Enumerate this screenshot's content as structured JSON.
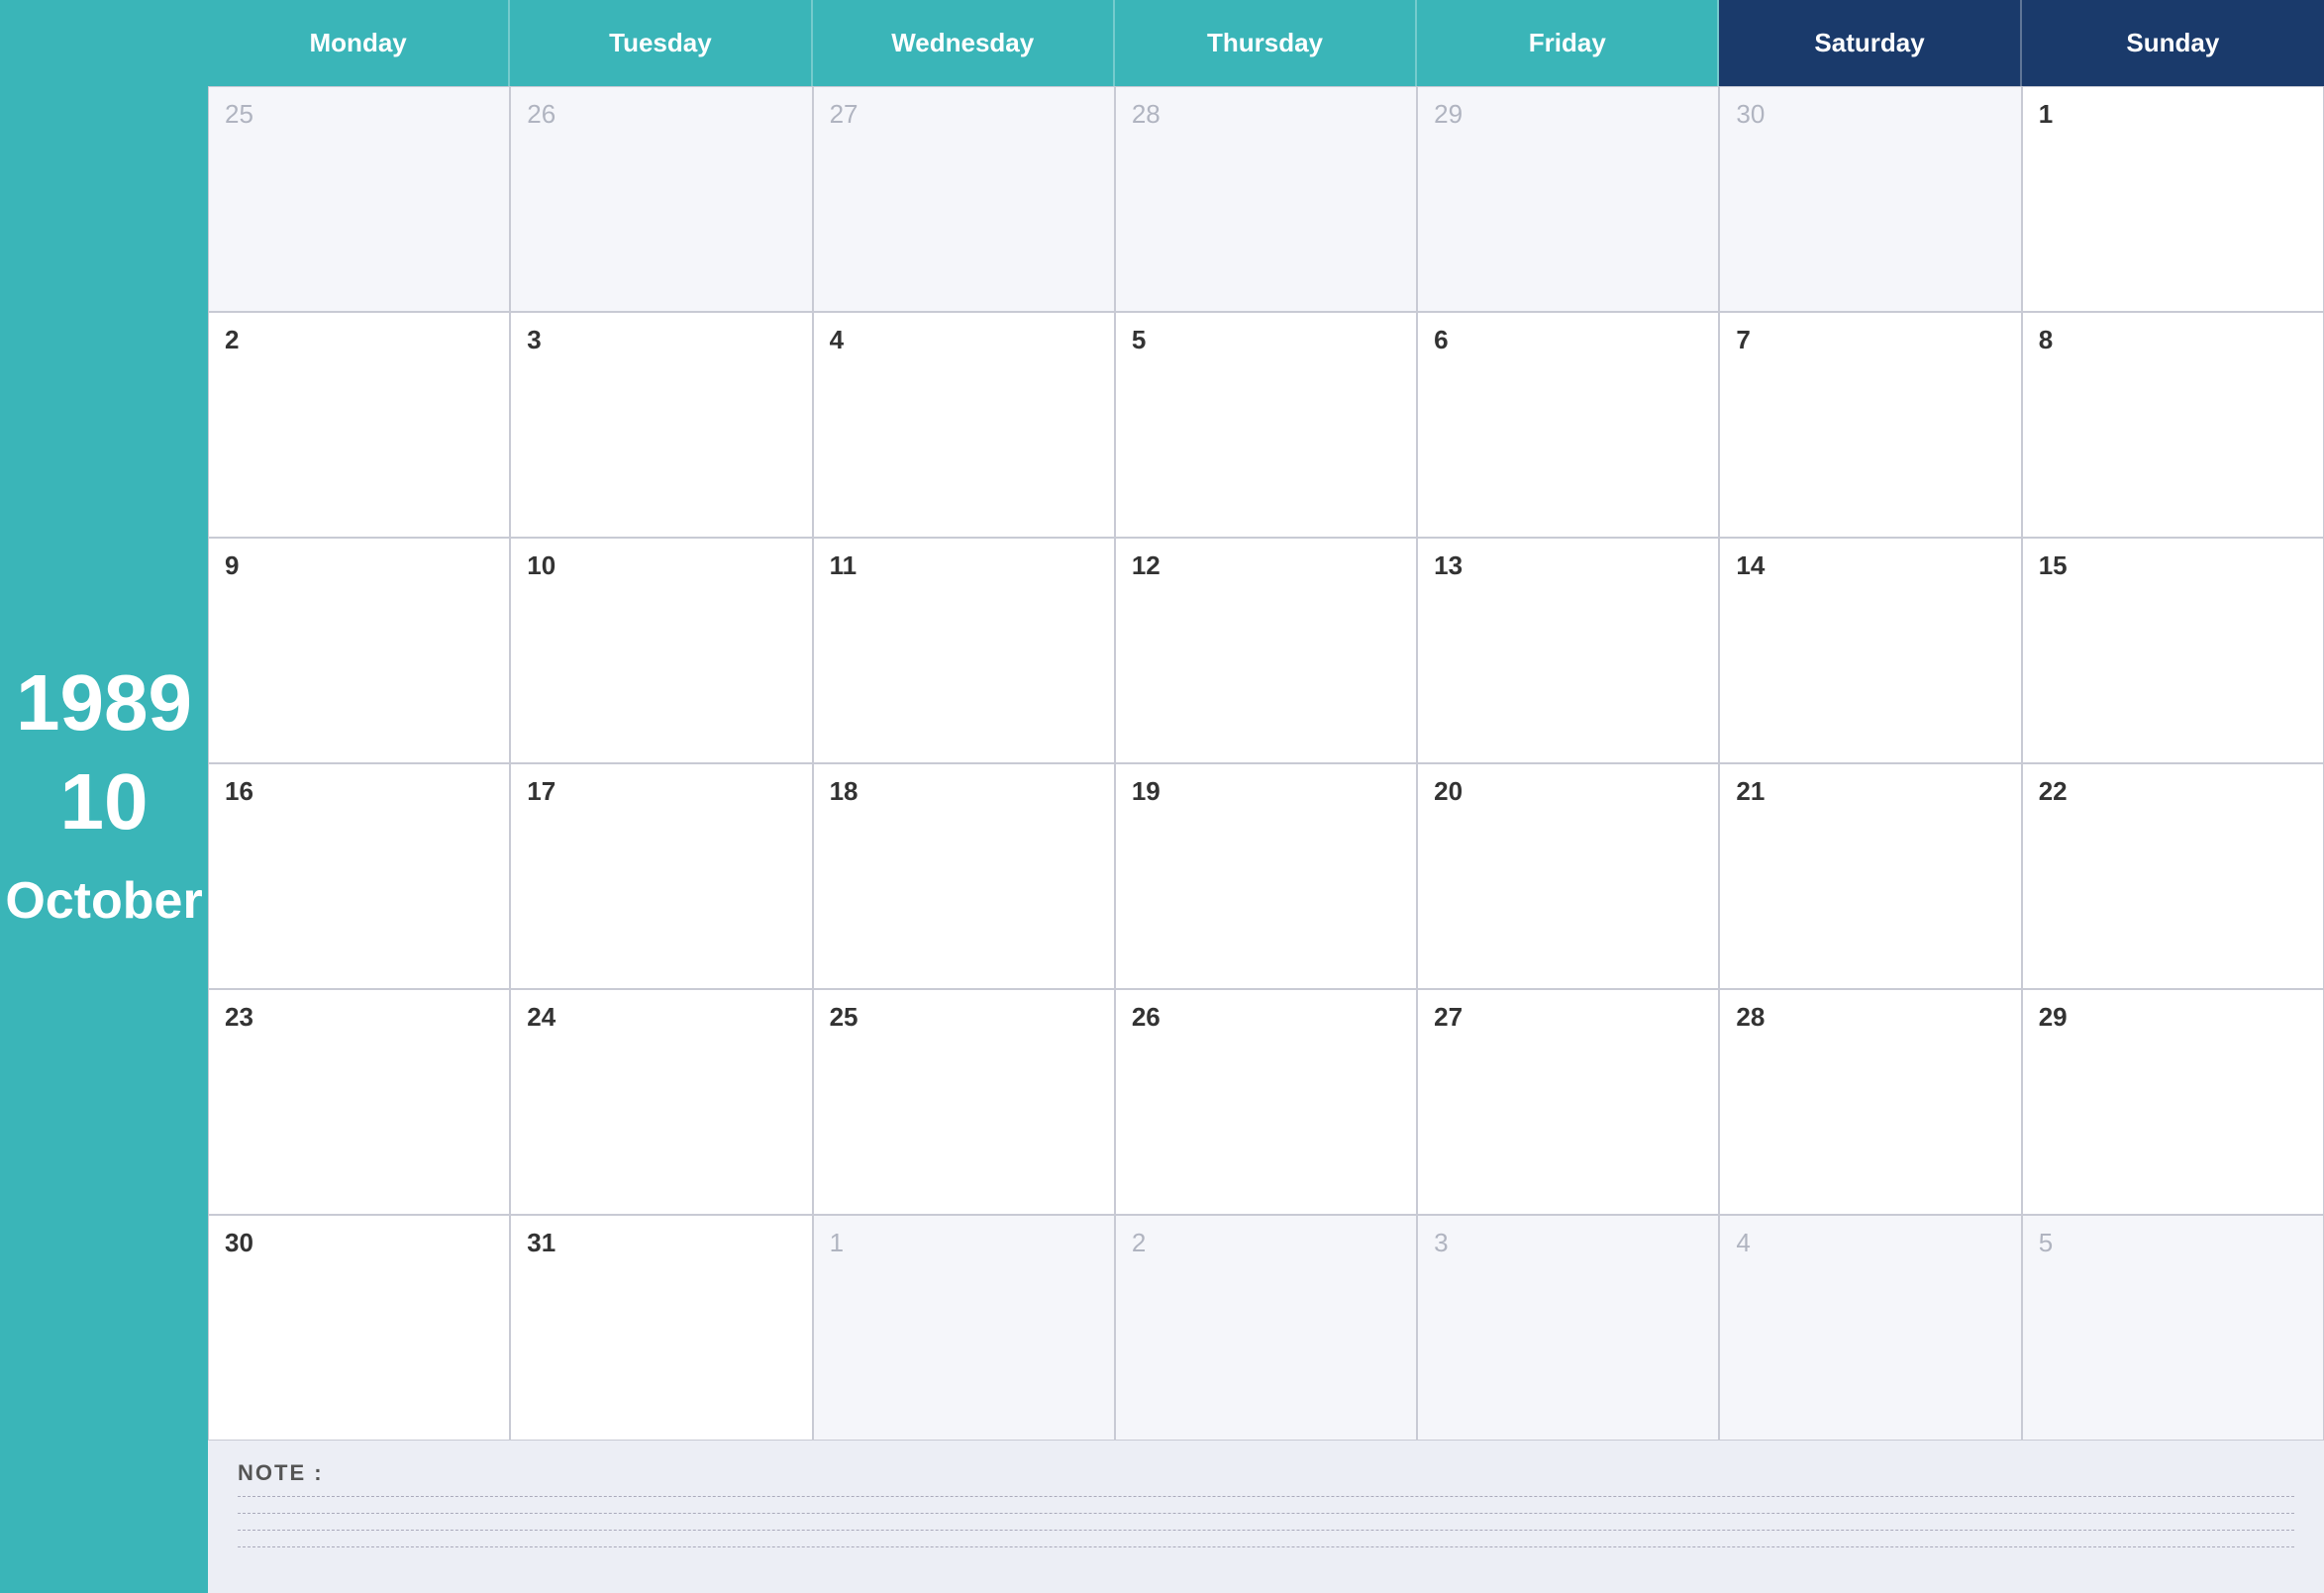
{
  "sidebar": {
    "year": "1989",
    "month_number": "10",
    "month_name": "October"
  },
  "header": {
    "days": [
      {
        "label": "Monday",
        "special": false
      },
      {
        "label": "Tuesday",
        "special": false
      },
      {
        "label": "Wednesday",
        "special": false
      },
      {
        "label": "Thursday",
        "special": false
      },
      {
        "label": "Friday",
        "special": false
      },
      {
        "label": "Saturday",
        "special": true
      },
      {
        "label": "Sunday",
        "special": true
      }
    ]
  },
  "weeks": [
    [
      {
        "date": "25",
        "outside": true
      },
      {
        "date": "26",
        "outside": true
      },
      {
        "date": "27",
        "outside": true
      },
      {
        "date": "28",
        "outside": true
      },
      {
        "date": "29",
        "outside": true
      },
      {
        "date": "30",
        "outside": true
      },
      {
        "date": "1",
        "outside": false
      }
    ],
    [
      {
        "date": "2",
        "outside": false
      },
      {
        "date": "3",
        "outside": false
      },
      {
        "date": "4",
        "outside": false
      },
      {
        "date": "5",
        "outside": false
      },
      {
        "date": "6",
        "outside": false
      },
      {
        "date": "7",
        "outside": false
      },
      {
        "date": "8",
        "outside": false
      }
    ],
    [
      {
        "date": "9",
        "outside": false
      },
      {
        "date": "10",
        "outside": false
      },
      {
        "date": "11",
        "outside": false
      },
      {
        "date": "12",
        "outside": false
      },
      {
        "date": "13",
        "outside": false
      },
      {
        "date": "14",
        "outside": false
      },
      {
        "date": "15",
        "outside": false
      }
    ],
    [
      {
        "date": "16",
        "outside": false
      },
      {
        "date": "17",
        "outside": false
      },
      {
        "date": "18",
        "outside": false
      },
      {
        "date": "19",
        "outside": false
      },
      {
        "date": "20",
        "outside": false
      },
      {
        "date": "21",
        "outside": false
      },
      {
        "date": "22",
        "outside": false
      }
    ],
    [
      {
        "date": "23",
        "outside": false
      },
      {
        "date": "24",
        "outside": false
      },
      {
        "date": "25",
        "outside": false
      },
      {
        "date": "26",
        "outside": false
      },
      {
        "date": "27",
        "outside": false
      },
      {
        "date": "28",
        "outside": false
      },
      {
        "date": "29",
        "outside": false
      }
    ],
    [
      {
        "date": "30",
        "outside": false
      },
      {
        "date": "31",
        "outside": false
      },
      {
        "date": "1",
        "outside": true
      },
      {
        "date": "2",
        "outside": true
      },
      {
        "date": "3",
        "outside": true
      },
      {
        "date": "4",
        "outside": true
      },
      {
        "date": "5",
        "outside": true
      }
    ]
  ],
  "notes": {
    "label": "NOTE :"
  },
  "colors": {
    "teal": "#3ab5b8",
    "navy": "#1a3a6b",
    "bg": "#eceef5"
  }
}
